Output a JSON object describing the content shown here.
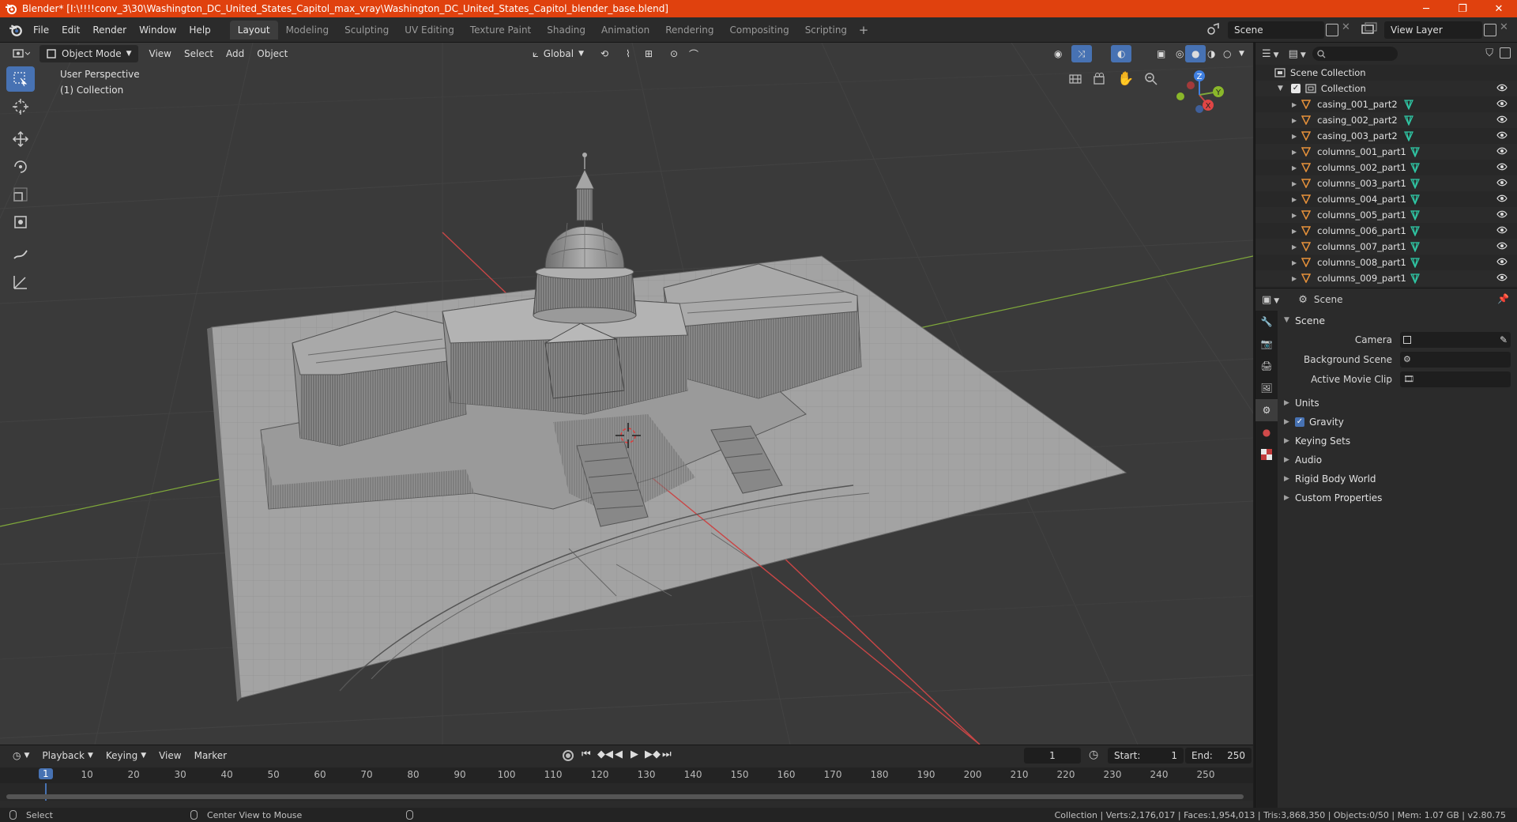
{
  "window": {
    "title": "Blender* [I:\\!!!!conv_3\\30\\Washington_DC_United_States_Capitol_max_vray\\Washington_DC_United_States_Capitol_blender_base.blend]",
    "minimize": "─",
    "maximize": "❐",
    "close": "✕"
  },
  "menu": [
    "File",
    "Edit",
    "Render",
    "Window",
    "Help"
  ],
  "workspaces": [
    "Layout",
    "Modeling",
    "Sculpting",
    "UV Editing",
    "Texture Paint",
    "Shading",
    "Animation",
    "Rendering",
    "Compositing",
    "Scripting"
  ],
  "active_workspace": "Layout",
  "scene_name": "Scene",
  "view_layer": "View Layer",
  "viewport": {
    "mode": "Object Mode",
    "menus": [
      "View",
      "Select",
      "Add",
      "Object"
    ],
    "transform_orientation": "Global",
    "info_line1": "User Perspective",
    "info_line2": "(1) Collection",
    "gizmo_axes": {
      "x": "X",
      "y": "Y",
      "z": "Z"
    }
  },
  "outliner": {
    "root": "Scene Collection",
    "collection": "Collection",
    "items": [
      "casing_001_part2",
      "casing_002_part2",
      "casing_003_part2",
      "columns_001_part1",
      "columns_002_part1",
      "columns_003_part1",
      "columns_004_part1",
      "columns_005_part1",
      "columns_006_part1",
      "columns_007_part1",
      "columns_008_part1",
      "columns_009_part1"
    ]
  },
  "properties": {
    "context": "Scene",
    "panel_title": "Scene",
    "camera_label": "Camera",
    "bg_scene_label": "Background Scene",
    "movie_clip_label": "Active Movie Clip",
    "subpanels": [
      "Units",
      "Gravity",
      "Keying Sets",
      "Audio",
      "Rigid Body World",
      "Custom Properties"
    ],
    "gravity_checked": true
  },
  "timeline": {
    "menus": [
      "Playback",
      "Keying",
      "View",
      "Marker"
    ],
    "current_frame": "1",
    "start_label": "Start:",
    "start": "1",
    "end_label": "End:",
    "end": "250",
    "ruler": [
      "1",
      "10",
      "20",
      "30",
      "40",
      "50",
      "60",
      "70",
      "80",
      "90",
      "100",
      "110",
      "120",
      "130",
      "140",
      "150",
      "160",
      "170",
      "180",
      "190",
      "200",
      "210",
      "220",
      "230",
      "240",
      "250"
    ]
  },
  "status": {
    "select": "Select",
    "center_view": "Center View to Mouse",
    "stats": "Collection | Verts:2,176,017 | Faces:1,954,013 | Tris:3,868,350 | Objects:0/50 | Mem: 1.07 GB | v2.80.75"
  },
  "colors": {
    "title_bar": "#e0410e",
    "accent_blue": "#4772b3",
    "x_axis": "#c94646",
    "y_axis": "#7fa83a",
    "z_axis": "#3f7fe0",
    "mesh_icon": "#2fc9a6",
    "object_icon": "#e8923a"
  }
}
